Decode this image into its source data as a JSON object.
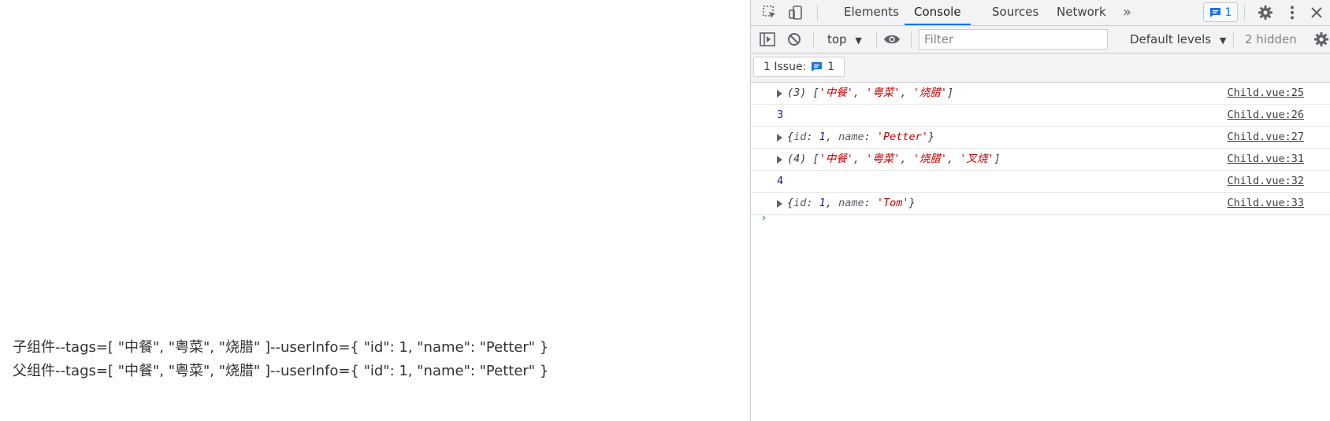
{
  "page": {
    "line1": "子组件--tags=[ \"中餐\", \"粤菜\", \"烧腊\" ]--userInfo={ \"id\": 1, \"name\": \"Petter\" }",
    "line2": "父组件--tags=[ \"中餐\", \"粤菜\", \"烧腊\" ]--userInfo={ \"id\": 1, \"name\": \"Petter\" }"
  },
  "devtools": {
    "tabs": [
      "Elements",
      "Console",
      "Sources",
      "Network"
    ],
    "active_tab": "Console",
    "more_tabs_glyph": "»",
    "issue_count": "1",
    "toolbar": {
      "context": "top",
      "filter_placeholder": "Filter",
      "levels": "Default levels",
      "hidden": "2 hidden"
    },
    "issue_bar": {
      "label": "1 Issue:",
      "count": "1"
    },
    "messages": [
      {
        "type": "array",
        "prefix": "(3) [",
        "items": [
          "'中餐'",
          "'粤菜'",
          "'烧腊'"
        ],
        "suffix": "]",
        "source": "Child.vue:25"
      },
      {
        "type": "number",
        "value": "3",
        "source": "Child.vue:26"
      },
      {
        "type": "object",
        "id": "1",
        "name": "'Petter'",
        "source": "Child.vue:27"
      },
      {
        "type": "array",
        "prefix": "(4) [",
        "items": [
          "'中餐'",
          "'粤菜'",
          "'烧腊'",
          "'叉烧'"
        ],
        "suffix": "]",
        "source": "Child.vue:31"
      },
      {
        "type": "number",
        "value": "4",
        "source": "Child.vue:32"
      },
      {
        "type": "object",
        "id": "1",
        "name": "'Tom'",
        "source": "Child.vue:33"
      }
    ],
    "prompt_glyph": "›"
  },
  "colors": {
    "accent": "#1a73e8",
    "string": "#c80000",
    "number": "#1a1aa6",
    "toolbar_bg": "#f1f3f4"
  }
}
